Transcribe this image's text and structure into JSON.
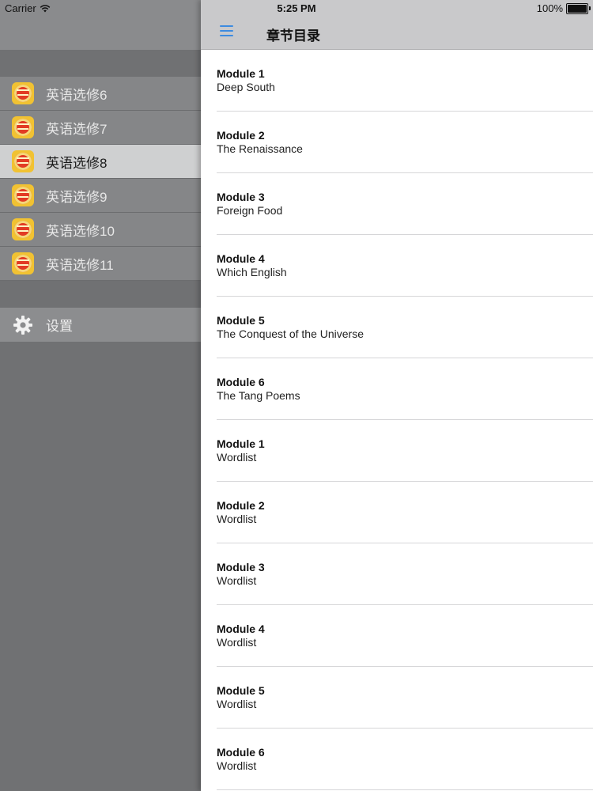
{
  "status_bar": {
    "carrier": "Carrier",
    "time": "5:25 PM",
    "battery": "100%",
    "wifi_icon": "wifi-icon",
    "battery_icon": "battery-icon"
  },
  "sidebar": {
    "books": [
      {
        "label": "英语选修6",
        "icon": "book-cover-icon"
      },
      {
        "label": "英语选修7",
        "icon": "book-cover-icon"
      },
      {
        "label": "英语选修8",
        "icon": "book-cover-icon",
        "selected": true
      },
      {
        "label": "英语选修9",
        "icon": "book-cover-icon"
      },
      {
        "label": "英语选修10",
        "icon": "book-cover-icon"
      },
      {
        "label": "英语选修11",
        "icon": "book-cover-icon"
      }
    ],
    "settings": {
      "label": "设置",
      "icon": "gear-icon"
    }
  },
  "navbar": {
    "title": "章节目录",
    "menu_icon": "hamburger-icon",
    "accent_color": "#3d8be0"
  },
  "chapters": [
    {
      "title": "Module 1",
      "subtitle": "Deep South"
    },
    {
      "title": "Module 2",
      "subtitle": "The Renaissance"
    },
    {
      "title": "Module 3",
      "subtitle": "Foreign Food"
    },
    {
      "title": "Module 4",
      "subtitle": "Which English"
    },
    {
      "title": "Module 5",
      "subtitle": "The Conquest of the Universe"
    },
    {
      "title": "Module 6",
      "subtitle": "The Tang Poems"
    },
    {
      "title": "Module 1",
      "subtitle": "Wordlist"
    },
    {
      "title": "Module 2",
      "subtitle": "Wordlist"
    },
    {
      "title": "Module 3",
      "subtitle": "Wordlist"
    },
    {
      "title": "Module 4",
      "subtitle": "Wordlist"
    },
    {
      "title": "Module 5",
      "subtitle": "Wordlist"
    },
    {
      "title": "Module 6",
      "subtitle": "Wordlist"
    }
  ]
}
